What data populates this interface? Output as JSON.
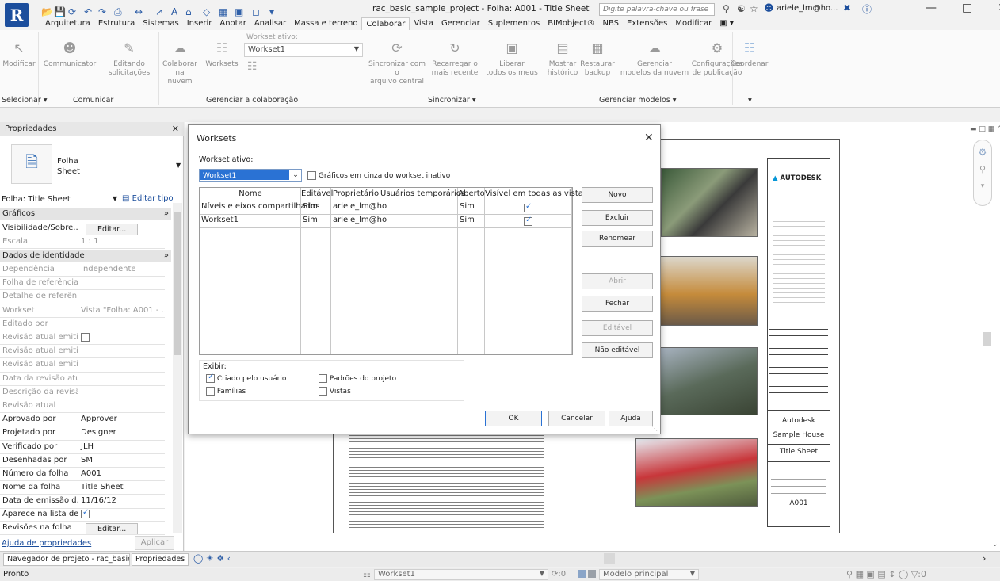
{
  "window": {
    "title": "rac_basic_sample_project - Folha: A001 - Title Sheet",
    "search_placeholder": "Digite palavra-chave ou frase",
    "user": "ariele_lm@ho...",
    "app_letter": "R"
  },
  "ribbon_tabs": [
    "Arquitetura",
    "Estrutura",
    "Sistemas",
    "Inserir",
    "Anotar",
    "Analisar",
    "Massa e terreno",
    "Colaborar",
    "Vista",
    "Gerenciar",
    "Suplementos",
    "BIMobject®",
    "NBS",
    "Extensões",
    "Modificar"
  ],
  "ribbon": {
    "modify": "Modificar",
    "communicator": "Communicator",
    "editing_requests": [
      "Editando",
      "solicitações"
    ],
    "collab_cloud": [
      "Colaborar na",
      "nuvem"
    ],
    "worksets": "Worksets",
    "active_workset_label": "Workset ativo:",
    "active_workset_value": "Workset1",
    "sync_central": [
      "Sincronizar com o",
      "arquivo central"
    ],
    "reload_latest": [
      "Recarregar o",
      "mais recente"
    ],
    "relinquish": [
      "Liberar",
      "todos os meus"
    ],
    "show_history": [
      "Mostrar",
      "histórico"
    ],
    "restore_backup": [
      "Restaurar",
      "backup"
    ],
    "manage_cloud": [
      "Gerenciar",
      "modelos da nuvem"
    ],
    "publish_settings": [
      "Configurações",
      "de publicação"
    ],
    "coordinate": "Coordenar",
    "panels": {
      "select": "Selecionar ▾",
      "communicate": "Comunicar",
      "manage_collab": "Gerenciar a colaboração",
      "sync": "Sincronizar ▾",
      "manage_models": "Gerenciar modelos ▾",
      "last": "▾"
    }
  },
  "properties": {
    "header": "Propriedades",
    "type_line1": "Folha",
    "type_line2": "Sheet",
    "selector": "Folha: Title Sheet",
    "edit_type": "Editar tipo",
    "sec_graphics": "Gráficos",
    "visibility_key": "Visibilidade/Sobre...",
    "visibility_btn": "Editar...",
    "scale_key": "Escala",
    "scale_val": "1 : 1",
    "sec_identity": "Dados de identidade",
    "rows": [
      {
        "k": "Dependência",
        "v": "Independente"
      },
      {
        "k": "Folha de referência",
        "v": ""
      },
      {
        "k": "Detalhe de referên...",
        "v": ""
      },
      {
        "k": "Workset",
        "v": "Vista \"Folha: A001 - ..."
      },
      {
        "k": "Editado por",
        "v": ""
      },
      {
        "k": "Revisão atual emiti...",
        "v": ""
      },
      {
        "k": "Revisão atual emiti...",
        "v": ""
      },
      {
        "k": "Revisão atual emiti...",
        "v": ""
      },
      {
        "k": "Data da revisão atu...",
        "v": ""
      },
      {
        "k": "Descrição da revisã...",
        "v": ""
      },
      {
        "k": "Revisão atual",
        "v": ""
      },
      {
        "k": "Aprovado por",
        "v": "Approver"
      },
      {
        "k": "Projetado por",
        "v": "Designer"
      },
      {
        "k": "Verificado por",
        "v": "JLH"
      },
      {
        "k": "Desenhadas por",
        "v": "SM"
      },
      {
        "k": "Número da folha",
        "v": "A001"
      },
      {
        "k": "Nome da folha",
        "v": "Title Sheet"
      },
      {
        "k": "Data de emissão d...",
        "v": "11/16/12"
      }
    ],
    "list_key": "Aparece na lista de...",
    "rev_key": "Revisões na folha",
    "rev_btn": "Editar...",
    "help": "Ajuda de propriedades",
    "apply": "Aplicar"
  },
  "dialog": {
    "title": "Worksets",
    "active_label": "Workset ativo:",
    "active_value": "Workset1",
    "gray_label": "Gráficos em cinza do workset inativo",
    "columns": [
      "Nome",
      "Editável",
      "Proprietário",
      "Usuários temporários",
      "Aberto",
      "Visível em todas as vistas"
    ],
    "rows": [
      {
        "name": "Níveis e eixos compartilhados",
        "editable": "Sim",
        "owner": "ariele_lm@ho",
        "borrowers": "",
        "open": "Sim"
      },
      {
        "name": "Workset1",
        "editable": "Sim",
        "owner": "ariele_lm@ho",
        "borrowers": "",
        "open": "Sim"
      }
    ],
    "buttons": {
      "new": "Novo",
      "delete": "Excluir",
      "rename": "Renomear",
      "open": "Abrir",
      "close": "Fechar",
      "editable": "Editável",
      "not_editable": "Não editável"
    },
    "show_label": "Exibir:",
    "show_options": {
      "user": "Criado pelo usuário",
      "families": "Famílias",
      "project": "Padrões do projeto",
      "views": "Vistas"
    },
    "ok": "OK",
    "cancel": "Cancelar",
    "help": "Ajuda"
  },
  "titleblock": {
    "brand": "AUTODESK",
    "company": "Autodesk",
    "project": "Sample House",
    "sheet_name": "Title Sheet",
    "sheet_number": "A001"
  },
  "navigator": {
    "browser_tab": "Navegador de projeto - rac_basic_sa...",
    "props_tab": "Propriedades"
  },
  "status": {
    "left": "Pronto",
    "workset": "Workset1",
    "zero": ":0",
    "model": "Modelo principal",
    "filter_count": ":0"
  }
}
